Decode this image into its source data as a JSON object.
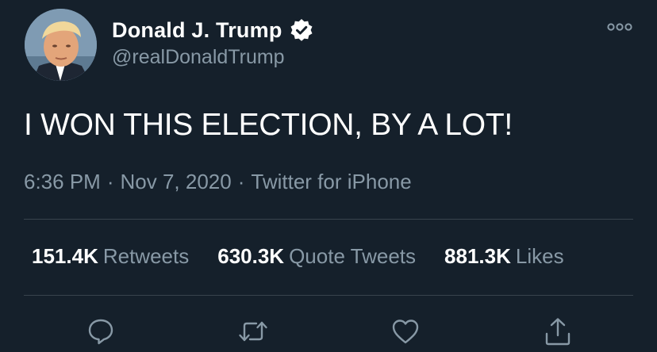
{
  "author": {
    "display_name": "Donald J. Trump",
    "handle": "@realDonaldTrump",
    "verified": true,
    "avatar": "profile-photo"
  },
  "tweet": {
    "text": "I WON THIS ELECTION, BY A LOT!",
    "time": "6:36 PM",
    "date": "Nov 7, 2020",
    "source": "Twitter for iPhone",
    "separator": "·"
  },
  "stats": [
    {
      "value": "151.4K",
      "label": "Retweets"
    },
    {
      "value": "630.3K",
      "label": "Quote Tweets"
    },
    {
      "value": "881.3K",
      "label": "Likes"
    }
  ],
  "actions": [
    "reply-icon",
    "retweet-icon",
    "like-icon",
    "share-icon"
  ],
  "icons": {
    "more": "more-options-icon",
    "verified": "verified-badge-icon"
  },
  "colors": {
    "background": "#15202b",
    "primary_text": "#ffffff",
    "secondary_text": "#8899a6",
    "divider": "#38444d"
  }
}
